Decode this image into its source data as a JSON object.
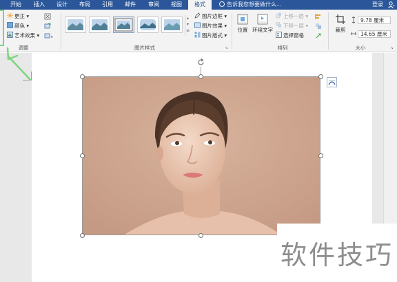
{
  "tabs": [
    {
      "label": "开始",
      "active": false
    },
    {
      "label": "插入",
      "active": false
    },
    {
      "label": "设计",
      "active": false
    },
    {
      "label": "布局",
      "active": false
    },
    {
      "label": "引用",
      "active": false
    },
    {
      "label": "邮件",
      "active": false
    },
    {
      "label": "审阅",
      "active": false
    },
    {
      "label": "视图",
      "active": false
    },
    {
      "label": "格式",
      "active": true
    }
  ],
  "tell_me": "告诉我您想要做什么...",
  "login": "登录",
  "ribbon": {
    "adjust": {
      "corrections": "更正",
      "color": "颜色",
      "artistic": "艺术效果",
      "group_label": "调整"
    },
    "styles": {
      "border": "图片边框",
      "effects": "图片效果",
      "layout": "图片版式",
      "group_label": "图片样式"
    },
    "arrange": {
      "position": "位置",
      "wrap": "环绕文字",
      "bring_forward": "上移一层",
      "send_backward": "下移一层",
      "selection_pane": "选择窗格",
      "group_label": "排列"
    },
    "size": {
      "crop": "裁剪",
      "height": "9.78 厘米",
      "width": "14.65 厘米",
      "group_label": "大小"
    }
  },
  "watermark": "软件技巧",
  "colors": {
    "tab_bar": "#2b579a",
    "ribbon_bg": "#f3f3f3",
    "photo_bg": "#c9a08a",
    "highlight": "#7ed47e"
  }
}
